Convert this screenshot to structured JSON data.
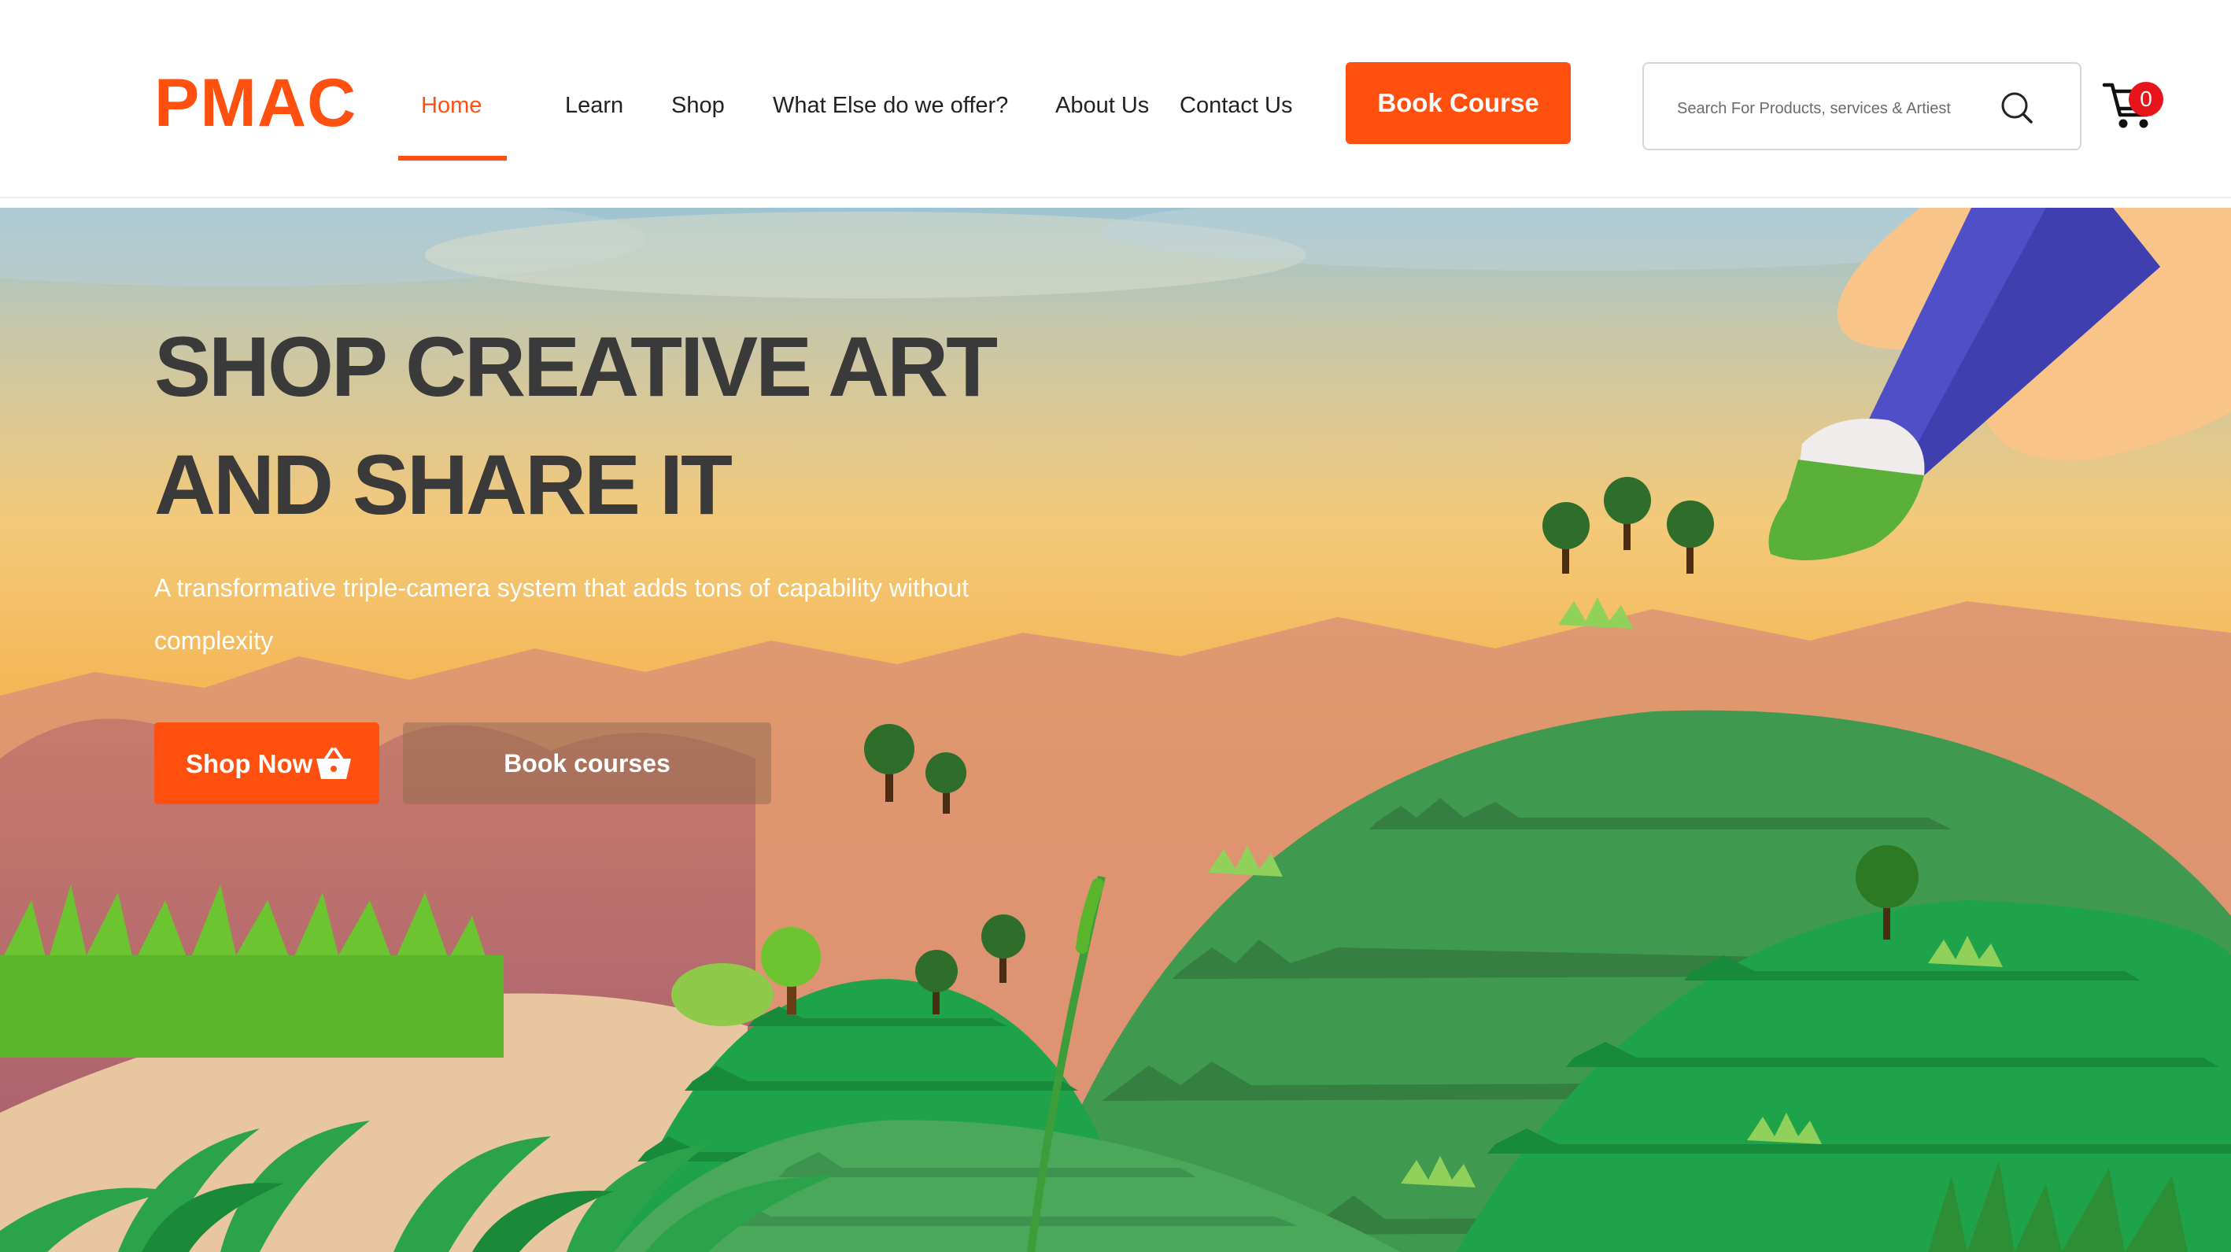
{
  "header": {
    "logo": "PMAC",
    "nav": [
      {
        "label": "Home",
        "active": true
      },
      {
        "label": "Learn",
        "active": false
      },
      {
        "label": "Shop",
        "active": false
      },
      {
        "label": "What Else do we offer?",
        "active": false
      },
      {
        "label": "About Us",
        "active": false
      },
      {
        "label": "Contact Us",
        "active": false
      }
    ],
    "book_course_label": "Book Course",
    "search": {
      "placeholder": "Search For Products, services & Artiest",
      "value": ""
    },
    "cart_count": "0"
  },
  "hero": {
    "title_line1": "SHOP CREATIVE ART",
    "title_line2": "AND SHARE IT",
    "description": "A transformative triple-camera system that adds tons of capability without complexity",
    "shop_now_label": "Shop Now",
    "book_courses_label": "Book courses"
  },
  "colors": {
    "accent": "#ff5010",
    "badge": "#e8141c",
    "hill": "#3f9a4f",
    "brush_handle": "#4f4fc8"
  },
  "icons": [
    "search-icon",
    "cart-icon",
    "basket-icon",
    "paintbrush-illustration"
  ]
}
